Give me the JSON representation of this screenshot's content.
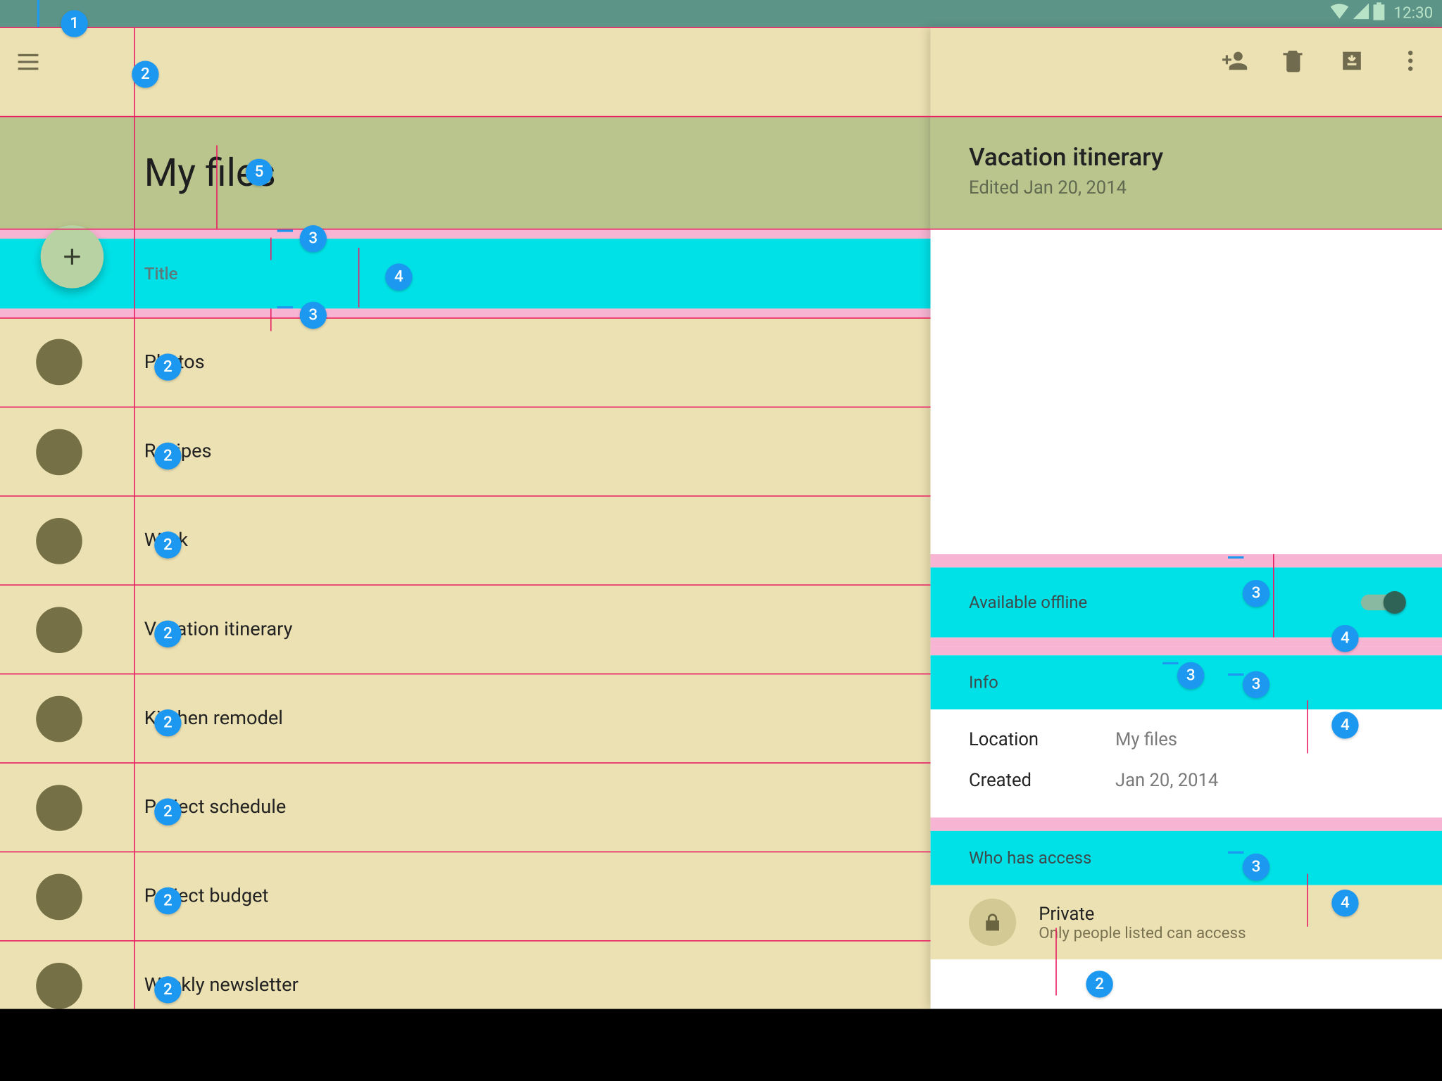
{
  "statusbar": {
    "time": "12:30"
  },
  "annotations": {
    "1": "1",
    "2": "2",
    "3": "3",
    "4": "4",
    "5": "5"
  },
  "left": {
    "title": "My files",
    "column_header": "Title",
    "items": [
      {
        "label": "Photos"
      },
      {
        "label": "Recipes"
      },
      {
        "label": "Work"
      },
      {
        "label": "Vacation itinerary"
      },
      {
        "label": "Kitchen remodel"
      },
      {
        "label": "Project schedule"
      },
      {
        "label": "Project budget"
      },
      {
        "label": "Weekly newsletter"
      }
    ]
  },
  "right": {
    "title": "Vacation itinerary",
    "subtitle": "Edited Jan 20, 2014",
    "offline_label": "Available offline",
    "info_label": "Info",
    "info": {
      "location_k": "Location",
      "location_v": "My files",
      "created_k": "Created",
      "created_v": "Jan 20, 2014"
    },
    "access_label": "Who has access",
    "access_item": {
      "title": "Private",
      "subtitle": "Only people listed can access"
    }
  }
}
